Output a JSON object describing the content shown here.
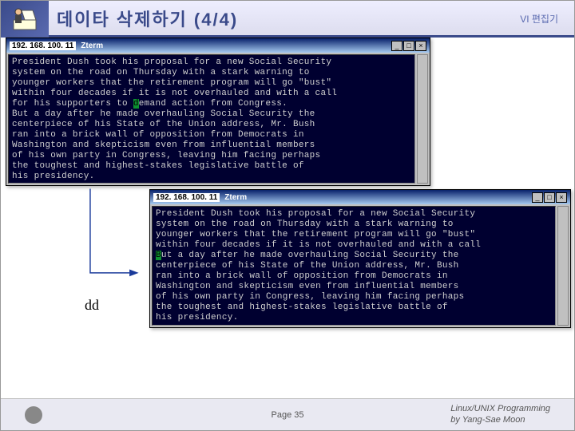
{
  "header": {
    "title": "데이타 삭제하기 (4/4)",
    "corner": "VI 편집기"
  },
  "cmd_label": "dd",
  "term1": {
    "ip": "192. 168. 100. 11",
    "app": "Zterm",
    "cursor_char": "d",
    "text_before": "President Dush took his proposal for a new Social Security\nsystem on the road on Thursday with a stark warning to\nyounger workers that the retirement program will go \"bust\"\nwithin four decades if it is not overhauled and with a call\nfor his supporters to ",
    "text_after": "emand action from Congress.\nBut a day after he made overhauling Social Security the\ncenterpiece of his State of the Union address, Mr. Bush\nran into a brick wall of opposition from Democrats in\nWashington and skepticism even from influential members\nof his own party in Congress, leaving him facing perhaps\nthe toughest and highest-stakes legislative battle of\nhis presidency."
  },
  "term2": {
    "ip": "192. 168. 100. 11",
    "app": "Zterm",
    "cursor_char": "B",
    "text_before": "President Dush took his proposal for a new Social Security\nsystem on the road on Thursday with a stark warning to\nyounger workers that the retirement program will go \"bust\"\nwithin four decades if it is not overhauled and with a call\n",
    "text_after": "ut a day after he made overhauling Social Security the\ncenterpiece of his State of the Union address, Mr. Bush\nran into a brick wall of opposition from Democrats in\nWashington and skepticism even from influential members\nof his own party in Congress, leaving him facing perhaps\nthe toughest and highest-stakes legislative battle of\nhis presidency."
  },
  "footer": {
    "page": "Page 35",
    "course": "Linux/UNIX Programming",
    "author": "by Yang-Sae Moon"
  },
  "winbtns": {
    "min": "_",
    "max": "□",
    "close": "×"
  }
}
